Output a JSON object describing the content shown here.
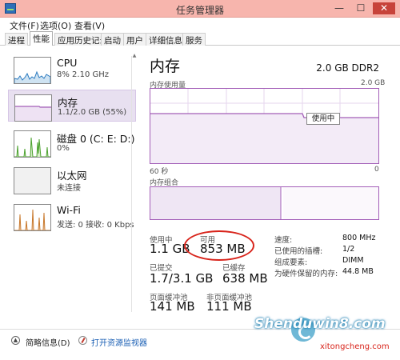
{
  "window": {
    "title": "任务管理器",
    "minimize": "—",
    "maximize": "☐",
    "close": "✕"
  },
  "menu": [
    "文件(F)",
    "选项(O)",
    "查看(V)"
  ],
  "tabs": [
    "进程",
    "性能",
    "应用历史记录",
    "启动",
    "用户",
    "详细信息",
    "服务"
  ],
  "active_tab": "性能",
  "sidebar": {
    "items": [
      {
        "name": "CPU",
        "detail": "8% 2.10 GHz",
        "icon": "cpu-graph-icon"
      },
      {
        "name": "内存",
        "detail": "1.1/2.0 GB (55%)",
        "icon": "memory-graph-icon"
      },
      {
        "name": "磁盘 0 (C: E: D:)",
        "detail": "0%",
        "icon": "disk-graph-icon"
      },
      {
        "name": "以太网",
        "detail": "未连接",
        "icon": "ethernet-graph-icon"
      },
      {
        "name": "Wi-Fi",
        "detail": "发送: 0 接收: 0 Kbps",
        "icon": "wifi-graph-icon"
      }
    ]
  },
  "main": {
    "title": "内存",
    "spec": "2.0 GB DDR2",
    "usage_graph_label": "内存使用量",
    "usage_graph_max": "2.0 GB",
    "usage_tooltip": "使用中",
    "time_start": "60 秒",
    "time_end": "0",
    "composition_label": "内存组合",
    "stats": {
      "in_use_label": "使用中",
      "in_use_value": "1.1 GB",
      "available_label": "可用",
      "available_value": "853 MB",
      "committed_label": "已提交",
      "committed_value": "1.7/3.1 GB",
      "cached_label": "已缓存",
      "cached_value": "638 MB",
      "paged_label": "页面缓冲池",
      "paged_value": "141 MB",
      "nonpaged_label": "非页面缓冲池",
      "nonpaged_value": "111 MB"
    },
    "details": [
      {
        "label": "速度:",
        "value": "800 MHz"
      },
      {
        "label": "已使用的插槽:",
        "value": "1/2"
      },
      {
        "label": "组成要素:",
        "value": "DIMM"
      },
      {
        "label": "为硬件保留的内存:",
        "value": "44.8 MB"
      }
    ]
  },
  "footer": {
    "fewer_details": "简略信息(D)",
    "resource_monitor": "打开资源监视器"
  },
  "watermark": {
    "main": "Shenduwin8.com",
    "sub": "xitongcheng.com"
  },
  "colors": {
    "accent": "#a35fb8",
    "titlebar": "#f7b5ad",
    "annotation": "#d8241b"
  }
}
